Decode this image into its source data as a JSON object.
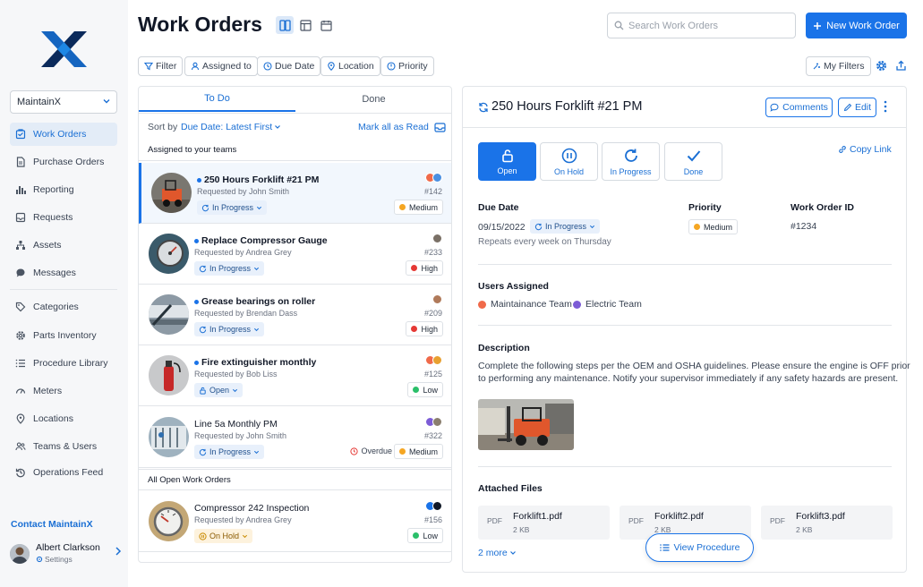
{
  "sidebar": {
    "org": "MaintainX",
    "items": [
      {
        "label": "Work Orders",
        "icon": "work-orders-icon",
        "active": true
      },
      {
        "label": "Purchase Orders",
        "icon": "purchase-orders-icon"
      },
      {
        "label": "Reporting",
        "icon": "reporting-icon"
      },
      {
        "label": "Requests",
        "icon": "requests-icon"
      },
      {
        "label": "Assets",
        "icon": "assets-icon"
      },
      {
        "label": "Messages",
        "icon": "messages-icon"
      },
      {
        "label": "Categories",
        "icon": "tag-icon"
      },
      {
        "label": "Parts Inventory",
        "icon": "gear-icon"
      },
      {
        "label": "Procedure Library",
        "icon": "list-icon"
      },
      {
        "label": "Meters",
        "icon": "meter-icon"
      },
      {
        "label": "Locations",
        "icon": "location-icon"
      },
      {
        "label": "Teams & Users",
        "icon": "users-icon"
      },
      {
        "label": "Operations Feed",
        "icon": "history-icon"
      }
    ],
    "contact": "Contact MaintainX",
    "user": {
      "name": "Albert Clarkson",
      "sub": "Settings"
    }
  },
  "header": {
    "title": "Work Orders",
    "search_placeholder": "Search Work Orders",
    "new_button": "New Work Order",
    "filters": [
      "Filter",
      "Assigned to",
      "Due Date",
      "Location",
      "Priority"
    ],
    "my_filters": "My Filters"
  },
  "list": {
    "tabs": [
      "To Do",
      "Done"
    ],
    "sort_prefix": "Sort by",
    "sort_value": "Due Date: Latest First",
    "mark_read": "Mark all as Read",
    "section1": "Assigned to your teams",
    "section2": "All Open Work Orders",
    "cards": [
      {
        "title": "250 Hours Forklift #21 PM",
        "req": "Requested by John Smith",
        "status": "In Progress",
        "num": "#142",
        "priority": "Medium",
        "prio_color": "#f5a623"
      },
      {
        "title": "Replace Compressor Gauge",
        "req": "Requested by Andrea Grey",
        "status": "In Progress",
        "num": "#233",
        "priority": "High",
        "prio_color": "#e53935"
      },
      {
        "title": "Grease bearings on roller",
        "req": "Requested by Brendan Dass",
        "status": "In Progress",
        "num": "#209",
        "priority": "High",
        "prio_color": "#e53935"
      },
      {
        "title": "Fire extinguisher monthly",
        "req": "Requested by Bob Liss",
        "status": "Open",
        "num": "#125",
        "priority": "Low",
        "prio_color": "#2bbf6a"
      },
      {
        "title": "Line 5a Monthly PM",
        "req": "Requested by John Smith",
        "status": "In Progress",
        "num": "#322",
        "priority": "Medium",
        "prio_color": "#f5a623",
        "overdue": "Overdue"
      },
      {
        "title": "Compressor 242 Inspection",
        "req": "Requested by Andrea Grey",
        "status": "On Hold",
        "num": "#156",
        "priority": "Low",
        "prio_color": "#2bbf6a"
      }
    ]
  },
  "detail": {
    "title": "250 Hours Forklift #21 PM",
    "comments": "Comments",
    "edit": "Edit",
    "status_buttons": [
      "Open",
      "On Hold",
      "In Progress",
      "Done"
    ],
    "copy_link": "Copy Link",
    "due_label": "Due Date",
    "due_value": "09/15/2022",
    "due_status": "In Progress",
    "repeats": "Repeats every week on Thursday",
    "priority_label": "Priority",
    "priority_value": "Medium",
    "id_label": "Work Order ID",
    "id_value": "#1234",
    "users_label": "Users Assigned",
    "team1": "Maintainance Team",
    "team2": "Electric Team",
    "desc_label": "Description",
    "desc_line1": "Complete the following steps per the OEM and OSHA guidelines. Please ensure the engine is OFF prior",
    "desc_line2": "to performing any maintenance. Notify your supervisor immediately if any safety hazards are present.",
    "files_label": "Attached Files",
    "files": [
      {
        "type": "PDF",
        "name": "Forklift1.pdf",
        "size": "2 KB"
      },
      {
        "type": "PDF",
        "name": "Forklift2.pdf",
        "size": "2 KB"
      },
      {
        "type": "PDF",
        "name": "Forklift3.pdf",
        "size": "2 KB"
      }
    ],
    "more": "2 more",
    "view_procedure": "View Procedure"
  }
}
